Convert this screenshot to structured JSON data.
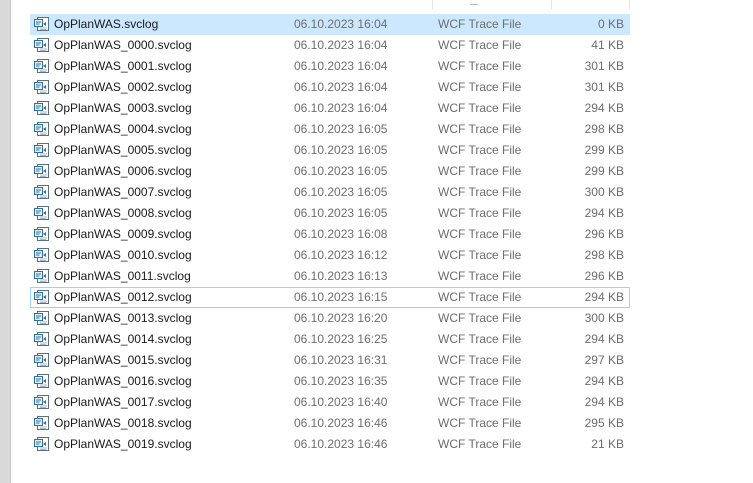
{
  "files": [
    {
      "name": "OpPlanWAS.svclog",
      "date": "06.10.2023 16:04",
      "type": "WCF Trace File",
      "size": "0 KB",
      "state": "selected"
    },
    {
      "name": "OpPlanWAS_0000.svclog",
      "date": "06.10.2023 16:04",
      "type": "WCF Trace File",
      "size": "41 KB",
      "state": ""
    },
    {
      "name": "OpPlanWAS_0001.svclog",
      "date": "06.10.2023 16:04",
      "type": "WCF Trace File",
      "size": "301 KB",
      "state": ""
    },
    {
      "name": "OpPlanWAS_0002.svclog",
      "date": "06.10.2023 16:04",
      "type": "WCF Trace File",
      "size": "301 KB",
      "state": ""
    },
    {
      "name": "OpPlanWAS_0003.svclog",
      "date": "06.10.2023 16:04",
      "type": "WCF Trace File",
      "size": "294 KB",
      "state": ""
    },
    {
      "name": "OpPlanWAS_0004.svclog",
      "date": "06.10.2023 16:05",
      "type": "WCF Trace File",
      "size": "298 KB",
      "state": ""
    },
    {
      "name": "OpPlanWAS_0005.svclog",
      "date": "06.10.2023 16:05",
      "type": "WCF Trace File",
      "size": "299 KB",
      "state": ""
    },
    {
      "name": "OpPlanWAS_0006.svclog",
      "date": "06.10.2023 16:05",
      "type": "WCF Trace File",
      "size": "299 KB",
      "state": ""
    },
    {
      "name": "OpPlanWAS_0007.svclog",
      "date": "06.10.2023 16:05",
      "type": "WCF Trace File",
      "size": "300 KB",
      "state": ""
    },
    {
      "name": "OpPlanWAS_0008.svclog",
      "date": "06.10.2023 16:05",
      "type": "WCF Trace File",
      "size": "294 KB",
      "state": ""
    },
    {
      "name": "OpPlanWAS_0009.svclog",
      "date": "06.10.2023 16:08",
      "type": "WCF Trace File",
      "size": "296 KB",
      "state": ""
    },
    {
      "name": "OpPlanWAS_0010.svclog",
      "date": "06.10.2023 16:12",
      "type": "WCF Trace File",
      "size": "298 KB",
      "state": ""
    },
    {
      "name": "OpPlanWAS_0011.svclog",
      "date": "06.10.2023 16:13",
      "type": "WCF Trace File",
      "size": "296 KB",
      "state": ""
    },
    {
      "name": "OpPlanWAS_0012.svclog",
      "date": "06.10.2023 16:15",
      "type": "WCF Trace File",
      "size": "294 KB",
      "state": "focused"
    },
    {
      "name": "OpPlanWAS_0013.svclog",
      "date": "06.10.2023 16:20",
      "type": "WCF Trace File",
      "size": "300 KB",
      "state": ""
    },
    {
      "name": "OpPlanWAS_0014.svclog",
      "date": "06.10.2023 16:25",
      "type": "WCF Trace File",
      "size": "294 KB",
      "state": ""
    },
    {
      "name": "OpPlanWAS_0015.svclog",
      "date": "06.10.2023 16:31",
      "type": "WCF Trace File",
      "size": "297 KB",
      "state": ""
    },
    {
      "name": "OpPlanWAS_0016.svclog",
      "date": "06.10.2023 16:35",
      "type": "WCF Trace File",
      "size": "294 KB",
      "state": ""
    },
    {
      "name": "OpPlanWAS_0017.svclog",
      "date": "06.10.2023 16:40",
      "type": "WCF Trace File",
      "size": "294 KB",
      "state": ""
    },
    {
      "name": "OpPlanWAS_0018.svclog",
      "date": "06.10.2023 16:46",
      "type": "WCF Trace File",
      "size": "295 KB",
      "state": ""
    },
    {
      "name": "OpPlanWAS_0019.svclog",
      "date": "06.10.2023 16:46",
      "type": "WCF Trace File",
      "size": "21 KB",
      "state": ""
    }
  ],
  "icon": "svclog-file-icon",
  "colors": {
    "selected_bg": "#cce8ff",
    "focus_border": "#99d1ff",
    "secondary_text": "#6d6d6d",
    "primary_text": "#1a1a1a"
  }
}
